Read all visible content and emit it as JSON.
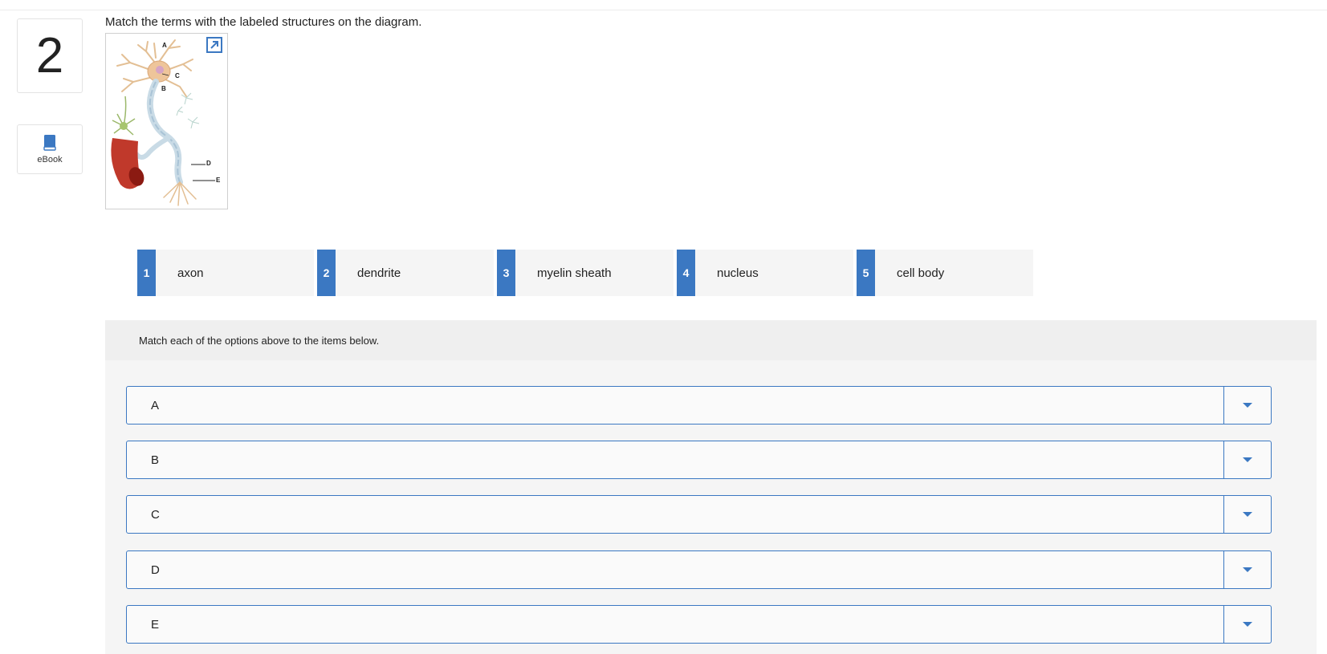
{
  "question": {
    "number": "2",
    "prompt": "Match the terms with the labeled structures on the diagram."
  },
  "sidebar": {
    "ebook_label": "eBook"
  },
  "diagram": {
    "labels": [
      "A",
      "B",
      "C",
      "D",
      "E"
    ],
    "expand_icon": "expand-icon"
  },
  "options": [
    {
      "num": "1",
      "label": "axon"
    },
    {
      "num": "2",
      "label": "dendrite"
    },
    {
      "num": "3",
      "label": "myelin sheath"
    },
    {
      "num": "4",
      "label": "nucleus"
    },
    {
      "num": "5",
      "label": "cell body"
    }
  ],
  "match": {
    "instruction": "Match each of the options above to the items below.",
    "items": [
      {
        "label": "A"
      },
      {
        "label": "B"
      },
      {
        "label": "C"
      },
      {
        "label": "D"
      },
      {
        "label": "E"
      }
    ]
  },
  "colors": {
    "accent": "#3b78c2",
    "option_bg": "#f5f5f5",
    "panel_bg": "#f5f5f5"
  }
}
